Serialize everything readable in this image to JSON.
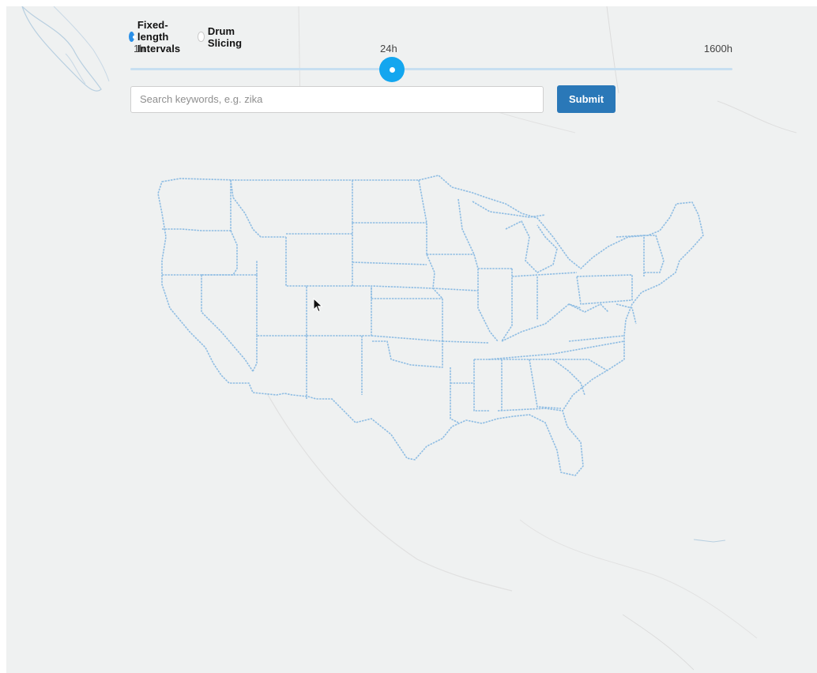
{
  "mode_selector": {
    "options": [
      {
        "label": "Fixed-length Intervals",
        "selected": true
      },
      {
        "label": "Drum Slicing",
        "selected": false
      }
    ]
  },
  "time_slider": {
    "min_label": "1h",
    "current_label": "24h",
    "max_label": "1600h",
    "position_fraction": 0.435
  },
  "search": {
    "placeholder": "Search keywords, e.g. zika",
    "value": "",
    "submit_label": "Submit"
  },
  "map": {
    "state_border_color": "#8fbde3",
    "background_color": "#eff1f1"
  },
  "colors": {
    "accent": "#13a6ef",
    "radio_selected": "#2b90e8",
    "submit": "#2a78b8"
  }
}
